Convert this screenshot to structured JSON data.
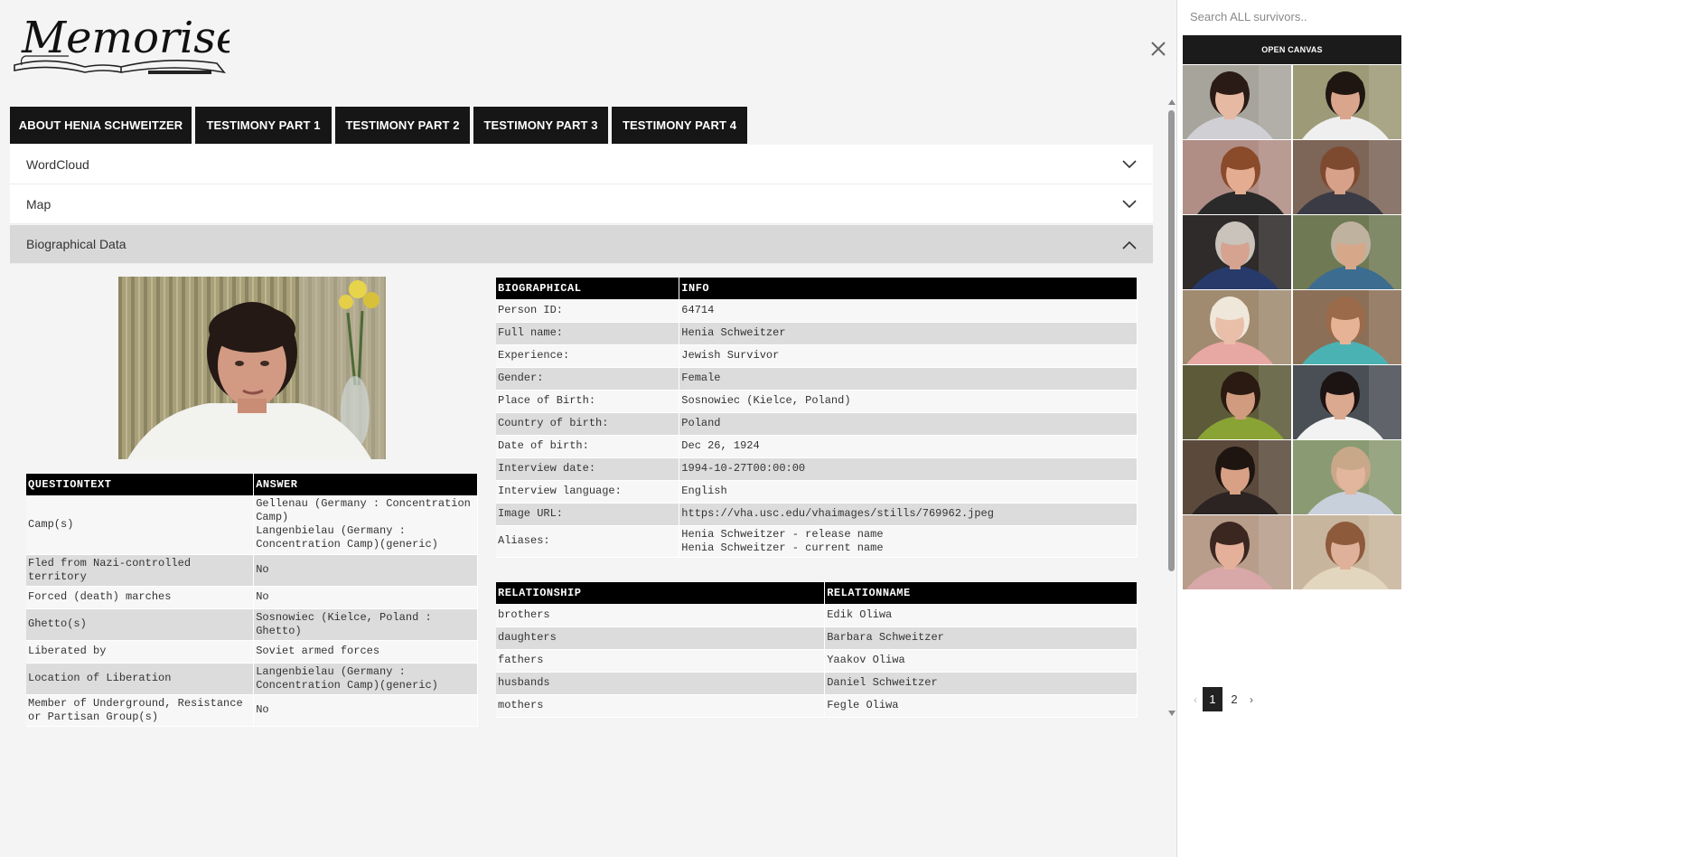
{
  "logo": {
    "text": "Memorise"
  },
  "tabs": [
    "ABOUT HENIA SCHWEITZER",
    "TESTIMONY PART 1",
    "TESTIMONY PART 2",
    "TESTIMONY PART 3",
    "TESTIMONY PART 4"
  ],
  "accordion": {
    "wordcloud": "WordCloud",
    "map": "Map",
    "bio": "Biographical Data"
  },
  "qa_table": {
    "headers": [
      "QUESTIONTEXT",
      "ANSWER"
    ],
    "rows": [
      [
        "Camp(s)",
        "Gellenau (Germany : Concentration Camp)\nLangenbielau (Germany : Concentration Camp)(generic)"
      ],
      [
        "Fled from Nazi-controlled territory",
        "No"
      ],
      [
        "Forced (death) marches",
        "No"
      ],
      [
        "Ghetto(s)",
        "Sosnowiec (Kielce, Poland : Ghetto)"
      ],
      [
        "Liberated by",
        "Soviet armed forces"
      ],
      [
        "Location of Liberation",
        "Langenbielau (Germany : Concentration Camp)(generic)"
      ],
      [
        "Member of Underground, Resistance or Partisan Group(s)",
        "No"
      ]
    ]
  },
  "bio_table": {
    "headers": [
      "BIOGRAPHICAL",
      "INFO"
    ],
    "rows": [
      [
        "Person ID:",
        "64714"
      ],
      [
        "Full name:",
        "Henia Schweitzer"
      ],
      [
        "Experience:",
        "Jewish Survivor"
      ],
      [
        "Gender:",
        "Female"
      ],
      [
        "Place of Birth:",
        "Sosnowiec (Kielce, Poland)"
      ],
      [
        "Country of birth:",
        "Poland"
      ],
      [
        "Date of birth:",
        "Dec 26, 1924"
      ],
      [
        "Interview date:",
        "1994-10-27T00:00:00"
      ],
      [
        "Interview language:",
        "English"
      ],
      [
        "Image URL:",
        "https://vha.usc.edu/vhaimages/stills/769962.jpeg"
      ],
      [
        "Aliases:",
        "Henia Schweitzer - release name\nHenia Schweitzer - current name"
      ]
    ]
  },
  "rel_table": {
    "headers": [
      "RELATIONSHIP",
      "RELATIONNAME"
    ],
    "rows": [
      [
        "brothers",
        "Edik Oliwa"
      ],
      [
        "daughters",
        "Barbara Schweitzer"
      ],
      [
        "fathers",
        "Yaakov Oliwa"
      ],
      [
        "husbands",
        "Daniel Schweitzer"
      ],
      [
        "mothers",
        "Fegle Oliwa"
      ]
    ]
  },
  "sidebar": {
    "search_placeholder": "Search ALL survivors..",
    "open_canvas": "OPEN CANVAS",
    "thumbs": [
      {
        "bg": "#a7a49c",
        "skin": "#e6b9a3",
        "hair": "#2b1b16",
        "shirt": "#cfcfd4"
      },
      {
        "bg": "#9c9a77",
        "skin": "#d9a58c",
        "hair": "#1f1612",
        "shirt": "#efefef"
      },
      {
        "bg": "#b08e86",
        "skin": "#e4ad91",
        "hair": "#8a4b2b",
        "shirt": "#2a2a2a"
      },
      {
        "bg": "#7d6558",
        "skin": "#d7a088",
        "hair": "#7d4a30",
        "shirt": "#3b3b45"
      },
      {
        "bg": "#2e2b2a",
        "skin": "#d5a390",
        "hair": "#c9c3bb",
        "shirt": "#273a6a"
      },
      {
        "bg": "#6f7a54",
        "skin": "#d6a789",
        "hair": "#bfb39f",
        "shirt": "#3c6c90"
      },
      {
        "bg": "#a08a70",
        "skin": "#e9bfa9",
        "hair": "#efe7da",
        "shirt": "#e7a7a2"
      },
      {
        "bg": "#8b6f57",
        "skin": "#e7b396",
        "hair": "#9a6a4a",
        "shirt": "#4bb2b3"
      },
      {
        "bg": "#5d5a3a",
        "skin": "#d09b7e",
        "hair": "#2a1a12",
        "shirt": "#8aa335"
      },
      {
        "bg": "#4a4f56",
        "skin": "#dba890",
        "hair": "#1c1412",
        "shirt": "#f2f2f2"
      },
      {
        "bg": "#5b4a3c",
        "skin": "#d8a085",
        "hair": "#1e1511",
        "shirt": "#2b2422"
      },
      {
        "bg": "#8a9a72",
        "skin": "#e2b59d",
        "hair": "#c9a88a",
        "shirt": "#c8d0db"
      },
      {
        "bg": "#b79d8a",
        "skin": "#e5b09a",
        "hair": "#3b2620",
        "shirt": "#d8a7a7"
      },
      {
        "bg": "#c8b59d",
        "skin": "#e0b19a",
        "hair": "#8d5a3b",
        "shirt": "#e3d6be"
      }
    ]
  },
  "pager": {
    "prev": "‹",
    "pages": [
      "1",
      "2"
    ],
    "next": "›"
  },
  "colors": {
    "tab_bg": "#161616",
    "table_header": "#000000",
    "row_alt": "#dcdcdc",
    "bio_open_bg": "#d8d8d8"
  }
}
